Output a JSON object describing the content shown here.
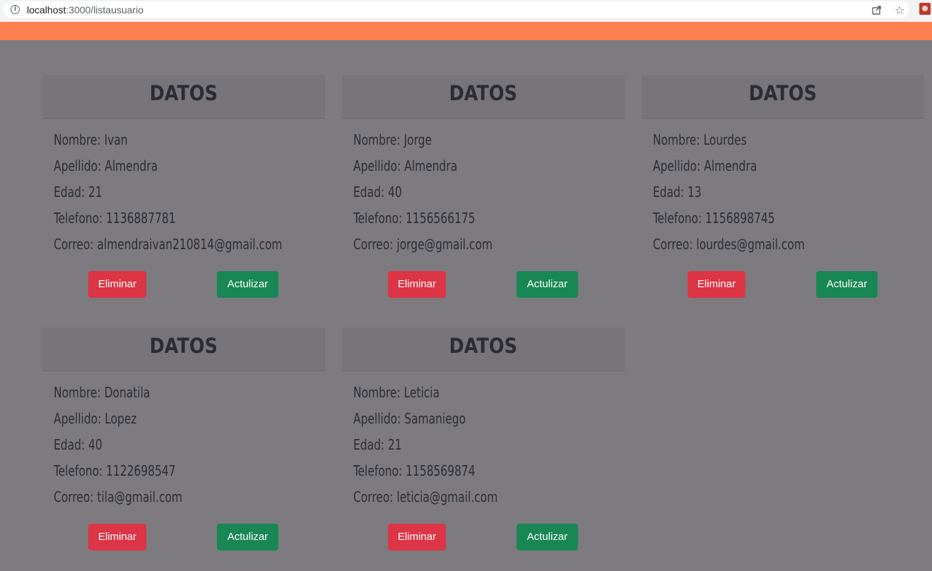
{
  "browser": {
    "url_host": "localhost",
    "url_path": ":3000/listausuario"
  },
  "cards": [
    {
      "title": "DATOS",
      "nombre": "Nombre: Ivan",
      "apellido": "Apellido: Almendra",
      "edad": "Edad: 21",
      "telefono": "Telefono: 1136887781",
      "correo": "Correo: almendraivan210814@gmail.com",
      "delete_label": "Eliminar",
      "update_label": "Actulizar"
    },
    {
      "title": "DATOS",
      "nombre": "Nombre: Jorge",
      "apellido": "Apellido: Almendra",
      "edad": "Edad: 40",
      "telefono": "Telefono: 1156566175",
      "correo": "Correo: jorge@gmail.com",
      "delete_label": "Eliminar",
      "update_label": "Actulizar"
    },
    {
      "title": "DATOS",
      "nombre": "Nombre: Lourdes",
      "apellido": "Apellido: Almendra",
      "edad": "Edad: 13",
      "telefono": "Telefono: 1156898745",
      "correo": "Correo: lourdes@gmail.com",
      "delete_label": "Eliminar",
      "update_label": "Actulizar"
    },
    {
      "title": "DATOS",
      "nombre": "Nombre: Donatila",
      "apellido": "Apellido: Lopez",
      "edad": "Edad: 40",
      "telefono": "Telefono: 1122698547",
      "correo": "Correo: tila@gmail.com",
      "delete_label": "Eliminar",
      "update_label": "Actulizar"
    },
    {
      "title": "DATOS",
      "nombre": "Nombre: Leticia",
      "apellido": "Apellido: Samaniego",
      "edad": "Edad: 21",
      "telefono": "Telefono: 1158569874",
      "correo": "Correo: leticia@gmail.com",
      "delete_label": "Eliminar",
      "update_label": "Actulizar"
    }
  ],
  "colors": {
    "navbar": "#ff7f50",
    "background": "#7d7b80",
    "delete_button": "#dc3545",
    "update_button": "#198754"
  },
  "icons": [
    "info-icon",
    "share-icon",
    "star-icon",
    "extension-icon"
  ]
}
